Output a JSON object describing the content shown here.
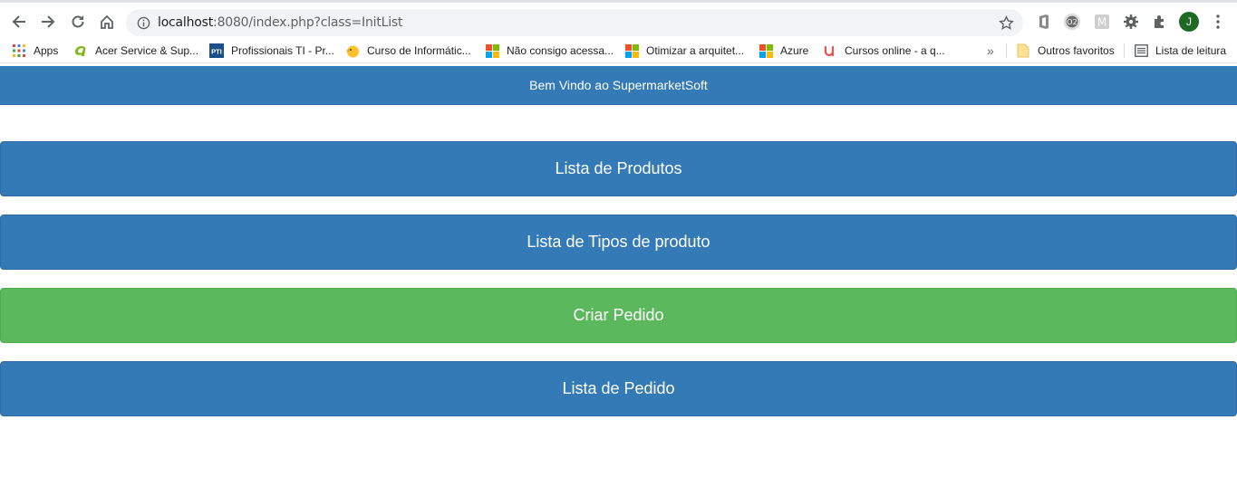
{
  "browser": {
    "url_host": "localhost",
    "url_rest": ":8080/index.php?class=InitList",
    "avatar_letter": "J",
    "bookmarks": [
      {
        "label": "Apps",
        "icon": "apps-grid-icon"
      },
      {
        "label": "Acer Service & Sup...",
        "icon": "acer-icon"
      },
      {
        "label": "Profissionais TI - Pr...",
        "icon": "pti-icon"
      },
      {
        "label": "Curso de Informátic...",
        "icon": "chick-icon"
      },
      {
        "label": "Não consigo acessa...",
        "icon": "microsoft-icon"
      },
      {
        "label": "Otimizar a arquitet...",
        "icon": "microsoft-icon"
      },
      {
        "label": "Azure",
        "icon": "microsoft-icon"
      },
      {
        "label": "Cursos online - a q...",
        "icon": "udemy-icon"
      }
    ],
    "overflow_label": "»",
    "other_favorites": "Outros favoritos",
    "reading_list": "Lista de leitura",
    "pti_text": "PTI"
  },
  "page": {
    "navbar_title": "Bem Vindo ao SupermarketSoft",
    "buttons": [
      {
        "label": "Lista de Produtos"
      },
      {
        "label": "Lista de Tipos de produto"
      },
      {
        "label": "Criar Pedido"
      },
      {
        "label": "Lista de Pedido"
      }
    ]
  },
  "colors": {
    "primary": "#337ab7",
    "success": "#5cb85c"
  }
}
